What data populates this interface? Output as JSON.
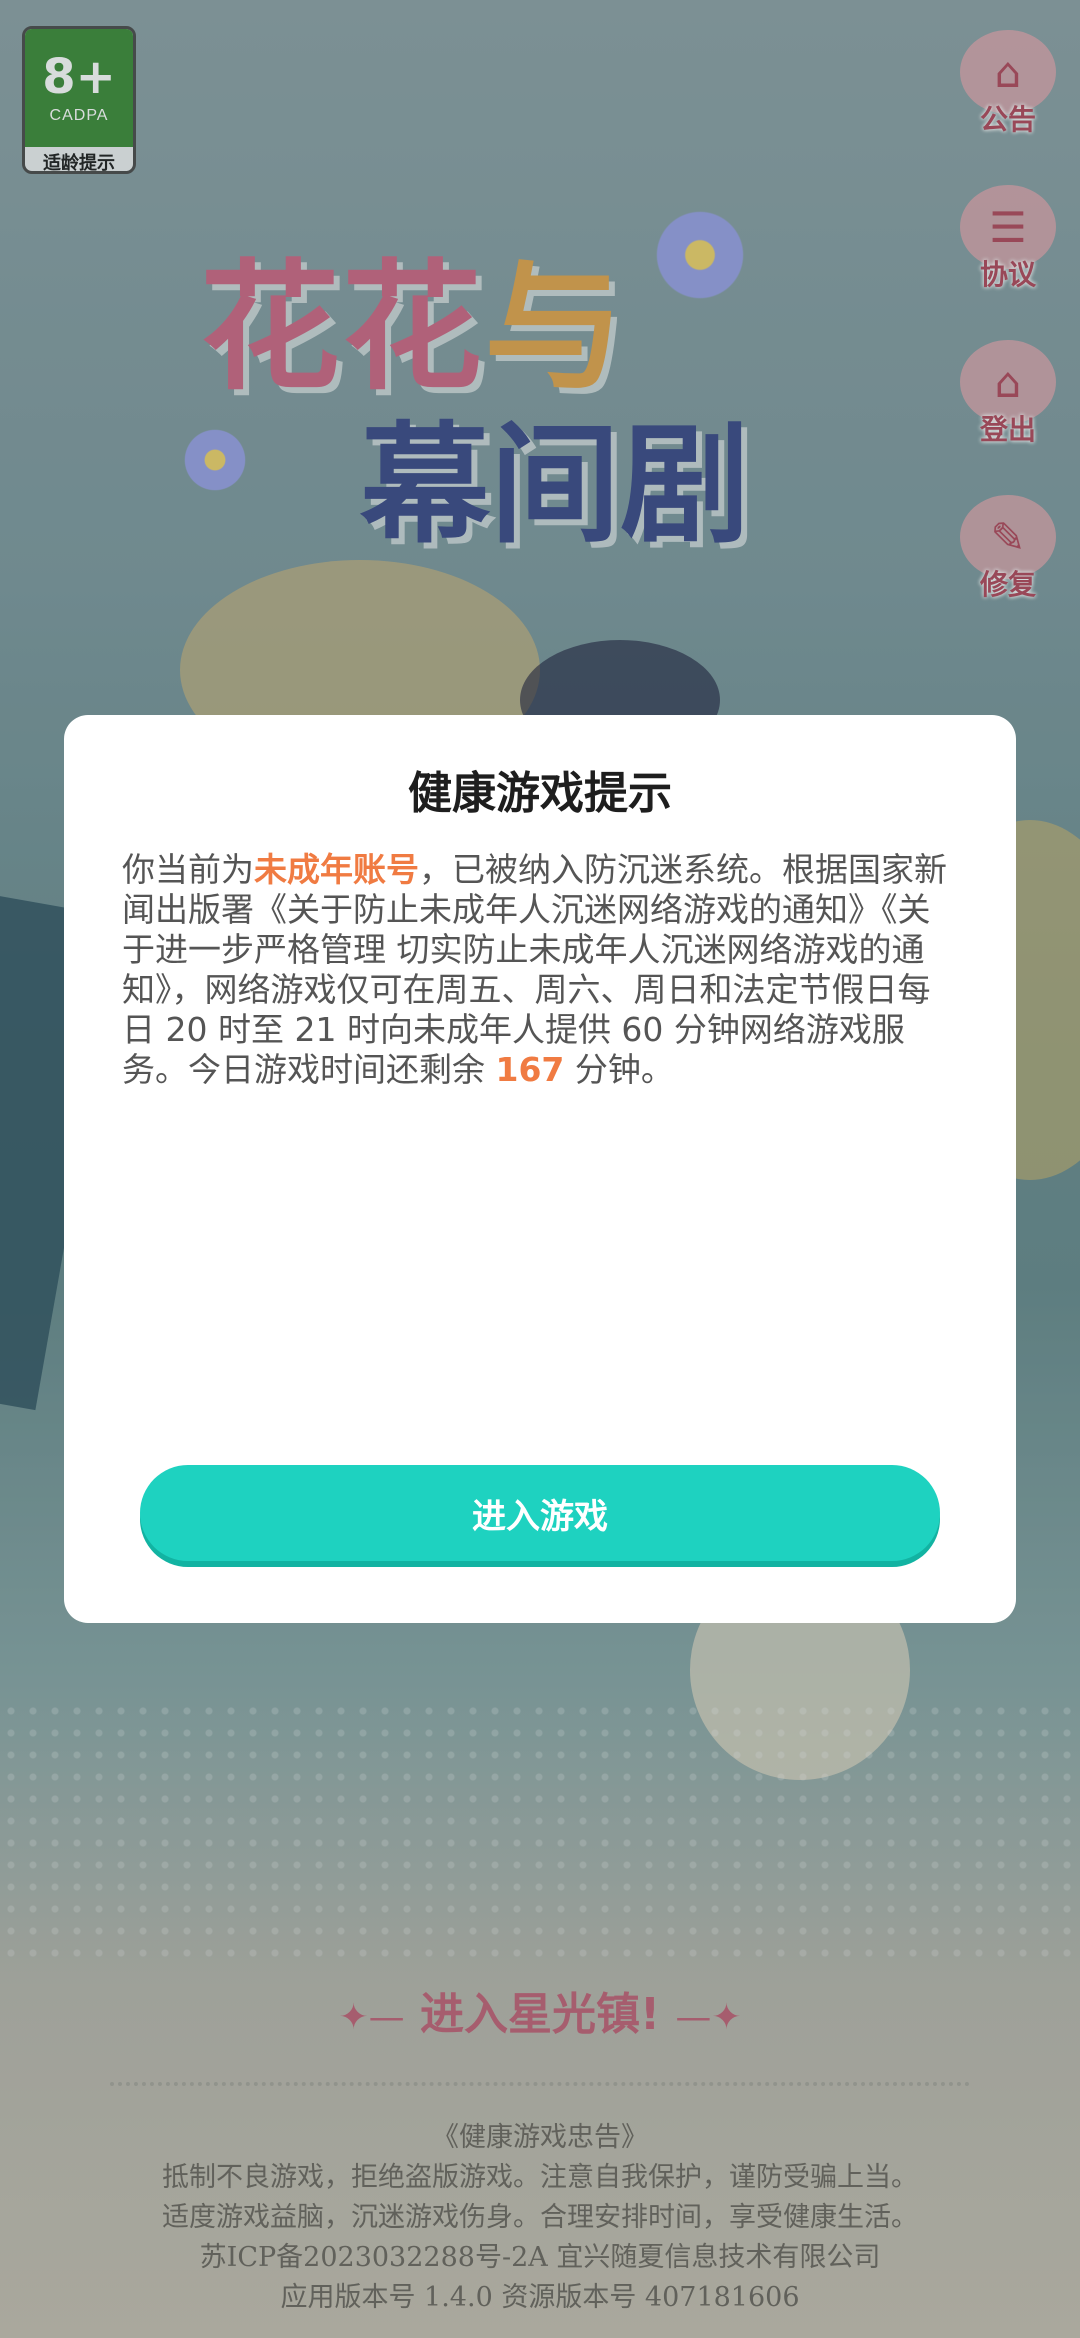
{
  "age_rating": {
    "number": "8+",
    "org": "CADPA",
    "label": "适龄提示"
  },
  "logo": {
    "line1_a": "花花",
    "line1_b": "与",
    "line2": "幕间剧"
  },
  "side_menu": [
    {
      "label": "公告",
      "icon": "notice-icon"
    },
    {
      "label": "协议",
      "icon": "agreement-icon"
    },
    {
      "label": "登出",
      "icon": "logout-icon"
    },
    {
      "label": "修复",
      "icon": "repair-icon"
    }
  ],
  "dialog": {
    "title": "健康游戏提示",
    "body_prefix": "你当前为",
    "body_highlight": "未成年账号",
    "body_main": "，已被纳入防沉迷系统。根据国家新闻出版署《关于防止未成年人沉迷网络游戏的通知》《关于进一步严格管理 切实防止未成年人沉迷网络游戏的通知》，网络游戏仅可在周五、周六、周日和法定节假日每日 20 时至 21 时向未成年人提供 60 分钟网络游戏服务。今日游戏时间还剩余 ",
    "remaining_minutes": "167",
    "body_suffix": " 分钟。",
    "enter_button": "进入游戏"
  },
  "start_prompt": "进入星光镇!",
  "footer": {
    "line1": "《健康游戏忠告》",
    "line2": "抵制不良游戏，拒绝盗版游戏。注意自我保护，谨防受骗上当。",
    "line3": "适度游戏益脑，沉迷游戏伤身。合理安排时间，享受健康生活。",
    "line4": "苏ICP备2023032288号-2A 宜兴随夏信息技术有限公司",
    "line5": "应用版本号 1.4.0 资源版本号 407181606"
  },
  "colors": {
    "highlight": "#f07b42",
    "button": "#1ed2c0"
  }
}
